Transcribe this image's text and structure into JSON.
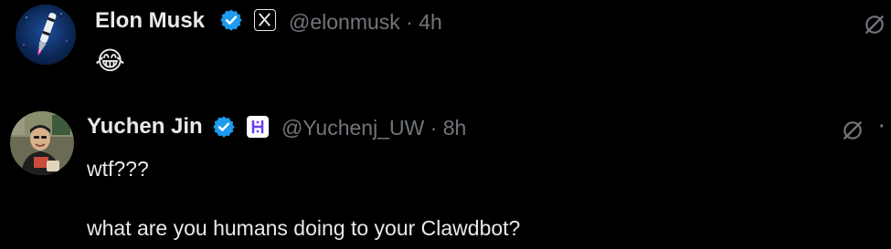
{
  "posts": [
    {
      "author": "Elon Musk",
      "handle": "@elonmusk",
      "separator": "·",
      "time": "4h",
      "verified": true,
      "affiliate_badge": "x-logo",
      "text": "😂",
      "avatar": "rocket-avatar"
    },
    {
      "author": "Yuchen Jin",
      "handle": "@Yuchenj_UW",
      "separator": "·",
      "time": "8h",
      "verified": true,
      "affiliate_badge": "hyperbolic-logo",
      "text_line1": "wtf???",
      "text_line2": "what are you humans doing to your Clawdbot?",
      "avatar": "person-avatar"
    }
  ],
  "colors": {
    "background": "#000000",
    "text": "#e7e9ea",
    "secondary": "#71767b",
    "verified": "#1d9bf0"
  }
}
